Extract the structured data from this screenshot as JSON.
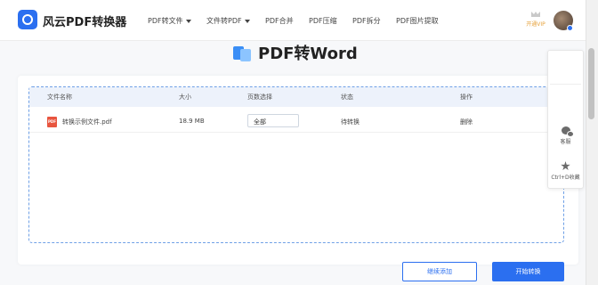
{
  "header": {
    "brand": "风云PDF转换器",
    "nav": [
      {
        "label": "PDF转文件"
      },
      {
        "label": "文件转PDF"
      },
      {
        "label": "PDF合并"
      },
      {
        "label": "PDF压缩"
      },
      {
        "label": "PDF拆分"
      },
      {
        "label": "PDF图片提取"
      }
    ],
    "vip_label": "开通VIP"
  },
  "page": {
    "title": "PDF转Word"
  },
  "table": {
    "columns": [
      "文件名称",
      "大小",
      "页数选择",
      "状态",
      "操作"
    ],
    "rows": [
      {
        "file_name": "转换示例文件.pdf",
        "file_type": "PDF",
        "size": "18.9 MB",
        "pages": "全部",
        "status": "待转换",
        "action": "删除"
      }
    ]
  },
  "buttons": {
    "add_more": "继续添加",
    "start": "开始转换"
  },
  "side_panel": {
    "service": "客服",
    "bookmark": "Ctrl+D收藏"
  },
  "colors": {
    "accent": "#2b6ff0",
    "vip": "#e6a23c",
    "pdf_icon": "#e8553f"
  }
}
